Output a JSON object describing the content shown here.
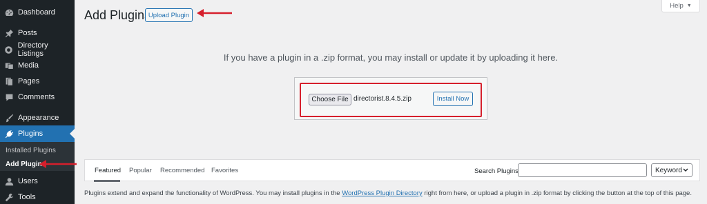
{
  "sidebar": {
    "items": [
      {
        "label": "Dashboard",
        "icon": "dashboard-icon"
      },
      {
        "label": "Posts",
        "icon": "pin-icon"
      },
      {
        "label": "Directory Listings",
        "icon": "directory-icon"
      },
      {
        "label": "Media",
        "icon": "media-icon"
      },
      {
        "label": "Pages",
        "icon": "pages-icon"
      },
      {
        "label": "Comments",
        "icon": "comments-icon"
      },
      {
        "label": "Appearance",
        "icon": "brush-icon"
      },
      {
        "label": "Plugins",
        "icon": "plug-icon"
      },
      {
        "label": "Users",
        "icon": "user-icon"
      },
      {
        "label": "Tools",
        "icon": "wrench-icon"
      }
    ],
    "submenu": {
      "installed": "Installed Plugins",
      "add": "Add Plugin"
    }
  },
  "header": {
    "title": "Add Plugins",
    "upload_label": "Upload Plugin",
    "help_label": "Help",
    "help_caret": "▼"
  },
  "upload": {
    "info": "If you have a plugin in a .zip format, you may install or update it by uploading it here.",
    "choose_file_label": "Choose File",
    "file_name": "directorist.8.4.5.zip",
    "install_label": "Install Now"
  },
  "filter": {
    "tabs": [
      "Featured",
      "Popular",
      "Recommended",
      "Favorites"
    ],
    "search_label": "Search Plugins",
    "search_value": "",
    "select_value": "Keyword"
  },
  "footer": {
    "before": "Plugins extend and expand the functionality of WordPress. You may install plugins in the ",
    "link": "WordPress Plugin Directory",
    "after": " right from here, or upload a plugin in .zip format by clicking the button at the top of this page."
  },
  "colors": {
    "sidebar_bg": "#1d2327",
    "accent": "#2271b1",
    "annotation_red": "#d61f2c"
  }
}
